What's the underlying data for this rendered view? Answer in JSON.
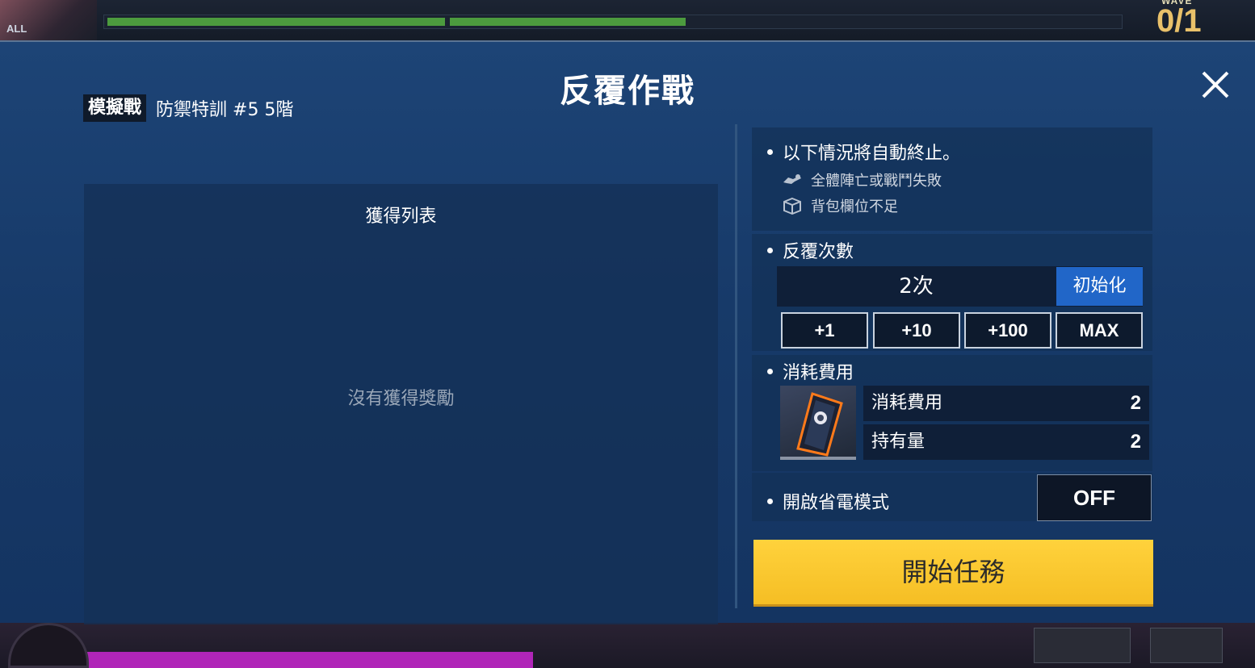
{
  "background": {
    "all_tag": "ALL",
    "wave_label": "WAVE",
    "wave_count": "0/1"
  },
  "modal": {
    "title": "反覆作戰",
    "close_icon": "close-icon"
  },
  "stage": {
    "tag": "模擬戰",
    "name": "防禦特訓 #5 5階"
  },
  "rewards": {
    "title": "獲得列表",
    "empty_text": "沒有獲得獎勵"
  },
  "auto_stop": {
    "title": "以下情況將自動終止。",
    "conditions": [
      {
        "icon": "fallen-unit-icon",
        "text": "全體陣亡或戰鬥失敗"
      },
      {
        "icon": "box-icon",
        "text": "背包欄位不足"
      }
    ]
  },
  "repeat": {
    "title": "反覆次數",
    "count": "2次",
    "reset_label": "初始化",
    "steps": [
      "+1",
      "+10",
      "+100",
      "MAX"
    ]
  },
  "cost": {
    "title": "消耗費用",
    "item_icon": "ticket-icon",
    "rows": [
      {
        "label": "消耗費用",
        "value": "2"
      },
      {
        "label": "持有量",
        "value": "2"
      }
    ]
  },
  "power_save": {
    "title": "開啟省電模式",
    "state": "OFF"
  },
  "start_label": "開始任務",
  "colors": {
    "modal_bg": "#1d4476",
    "reset_blue": "#2166c8",
    "start_yellow": "#f5be24",
    "wave_gold": "#e9c16a"
  }
}
